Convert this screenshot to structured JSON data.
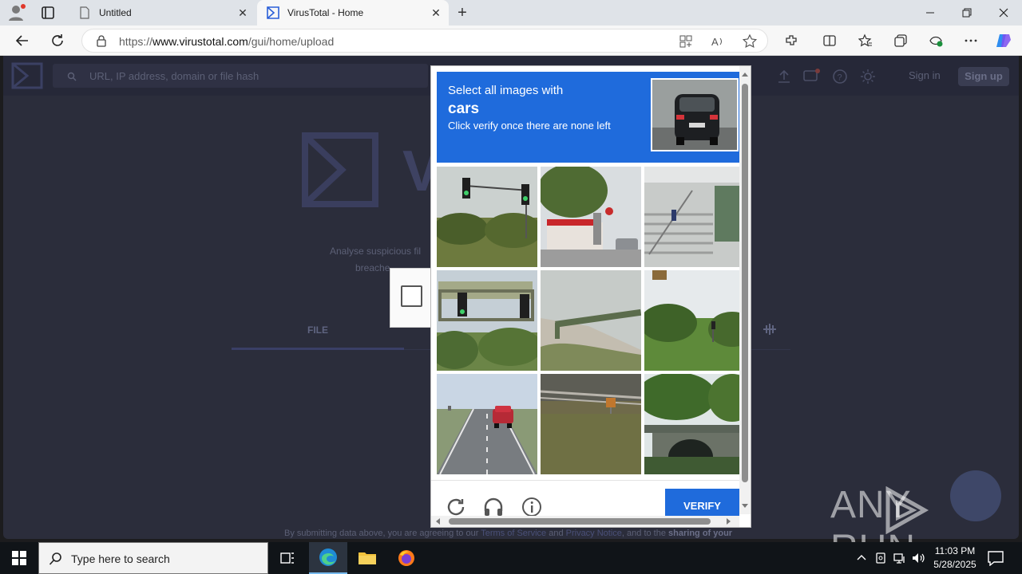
{
  "browser": {
    "tabs": [
      {
        "title": "Untitled",
        "active": false
      },
      {
        "title": "VirusTotal - Home",
        "active": true
      }
    ],
    "url_prefix": "https://",
    "url_host": "www.virustotal.com",
    "url_path": "/gui/home/upload"
  },
  "vt": {
    "search_placeholder": "URL, IP address, domain or file hash",
    "signin_label": "Sign in",
    "signup_label": "Sign up",
    "big_letter": "V",
    "tagline_line1": "Analyse suspicious fil",
    "tagline_line2": "breache",
    "file_tab": "FILE",
    "footer_note_start": "By submitting data above, you are agreeing to our ",
    "terms_link": "Terms of Service",
    "and_text": " and ",
    "privacy_link": "Privacy Notice",
    "footer_note_end": ", and to the ",
    "sharing_text": "sharing of your"
  },
  "captcha": {
    "prompt_line1": "Select all images with",
    "prompt_object": "cars",
    "prompt_line3": "Click verify once there are none left",
    "verify_label": "VERIFY",
    "tiles": [
      "traffic-lights-trees",
      "gas-station-street",
      "stairs-building",
      "traffic-light-overpass",
      "bridge-hillside",
      "trees-field-traffic-light",
      "road-with-red-car",
      "railway-track-field",
      "stone-bridge-trees"
    ]
  },
  "watermark": {
    "text_left": "ANY",
    "text_right": "RUN"
  },
  "taskbar": {
    "search_placeholder": "Type here to search",
    "time": "11:03 PM",
    "date": "5/28/2025"
  },
  "colors": {
    "captcha_blue": "#1f6bdc",
    "vt_bg": "#2b2d3b",
    "vt_header": "#262838"
  }
}
